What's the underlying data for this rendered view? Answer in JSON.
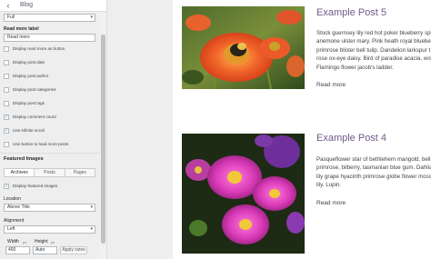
{
  "customizer": {
    "back_icon": "chevron-left-icon",
    "panel_title": "Blog",
    "top_select_value": "Full",
    "read_more_label_heading": "Read more label",
    "read_more_label_value": "Read more",
    "checkboxes": [
      {
        "label": "Display read more as button",
        "checked": false
      },
      {
        "label": "Display post date",
        "checked": false
      },
      {
        "label": "Display post author",
        "checked": false
      },
      {
        "label": "Display post categories",
        "checked": false
      },
      {
        "label": "Display post tags",
        "checked": false
      },
      {
        "label": "Display comment count",
        "checked": true
      },
      {
        "label": "Use infinite scroll",
        "checked": true
      },
      {
        "label": "Use button to load more posts",
        "checked": false
      }
    ],
    "featured_images_heading": "Featured Images",
    "tabs": [
      {
        "label": "Archives",
        "active": true
      },
      {
        "label": "Posts",
        "active": false
      },
      {
        "label": "Pages",
        "active": false
      }
    ],
    "display_featured_images": {
      "label": "Display featured images",
      "checked": true
    },
    "location_label": "Location",
    "location_value": "Above Title",
    "alignment_label": "Alignment",
    "alignment_value": "Left",
    "width_label": "Width",
    "height_label": "Height",
    "width_unit": "px",
    "height_unit": "px",
    "width_value": "400",
    "height_value": "Auto",
    "apply_button": "Apply sizes"
  },
  "posts": [
    {
      "title": "Example Post 5",
      "excerpt_lines": [
        "Stock guernsey lily red hot poker blueberry spide",
        "anemone ulster mary. Pink heath royal bluebell s",
        "primrose blister bell tulip. Dandelion larkspur t",
        "rose ox-eye daisy. Bird of paradise acacia, wove",
        "Flamingo flower jacob's ladder."
      ],
      "read_more": "Read more",
      "image": "orange-daisy-with-bee"
    },
    {
      "title": "Example Post 4",
      "excerpt_lines": [
        "Pasqueflower star of bethlehem mangold, bell flo",
        "primrose, bilberry, tasmanian blue gum. Dahlia t",
        "lily grape hyacinth primrose globe flower moss ph",
        "lily. Lupin."
      ],
      "read_more": "Read more",
      "image": "purple-daisies"
    }
  ],
  "colors": {
    "panel_bg": "#eeeeee",
    "post_title": "#6f5a8a",
    "checkbox_check": "#1e8cbe"
  }
}
